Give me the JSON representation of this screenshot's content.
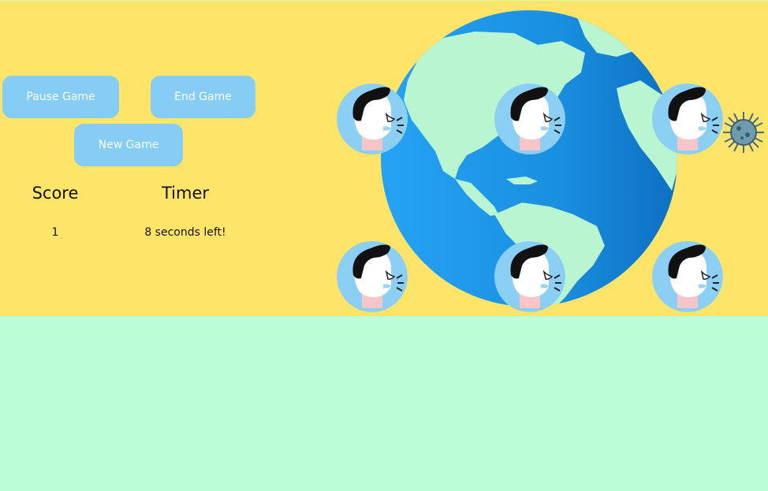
{
  "controls": {
    "pause_label": "Pause Game",
    "end_label": "End Game",
    "new_label": "New Game"
  },
  "stats": {
    "score_label": "Score",
    "timer_label": "Timer",
    "score_value": "1",
    "timer_value": "8 seconds left!"
  },
  "colors": {
    "top_background": "#ffe46a",
    "bottom_background": "#bbfdd6",
    "button": "#85cdf5",
    "ocean": "#1a8fe0",
    "land": "#b8f5d0",
    "avatar_bg": "#8ccff5"
  },
  "icons": {
    "globe": "earth-globe-icon",
    "person": "sneezing-person-icon",
    "virus": "coronavirus-icon"
  }
}
